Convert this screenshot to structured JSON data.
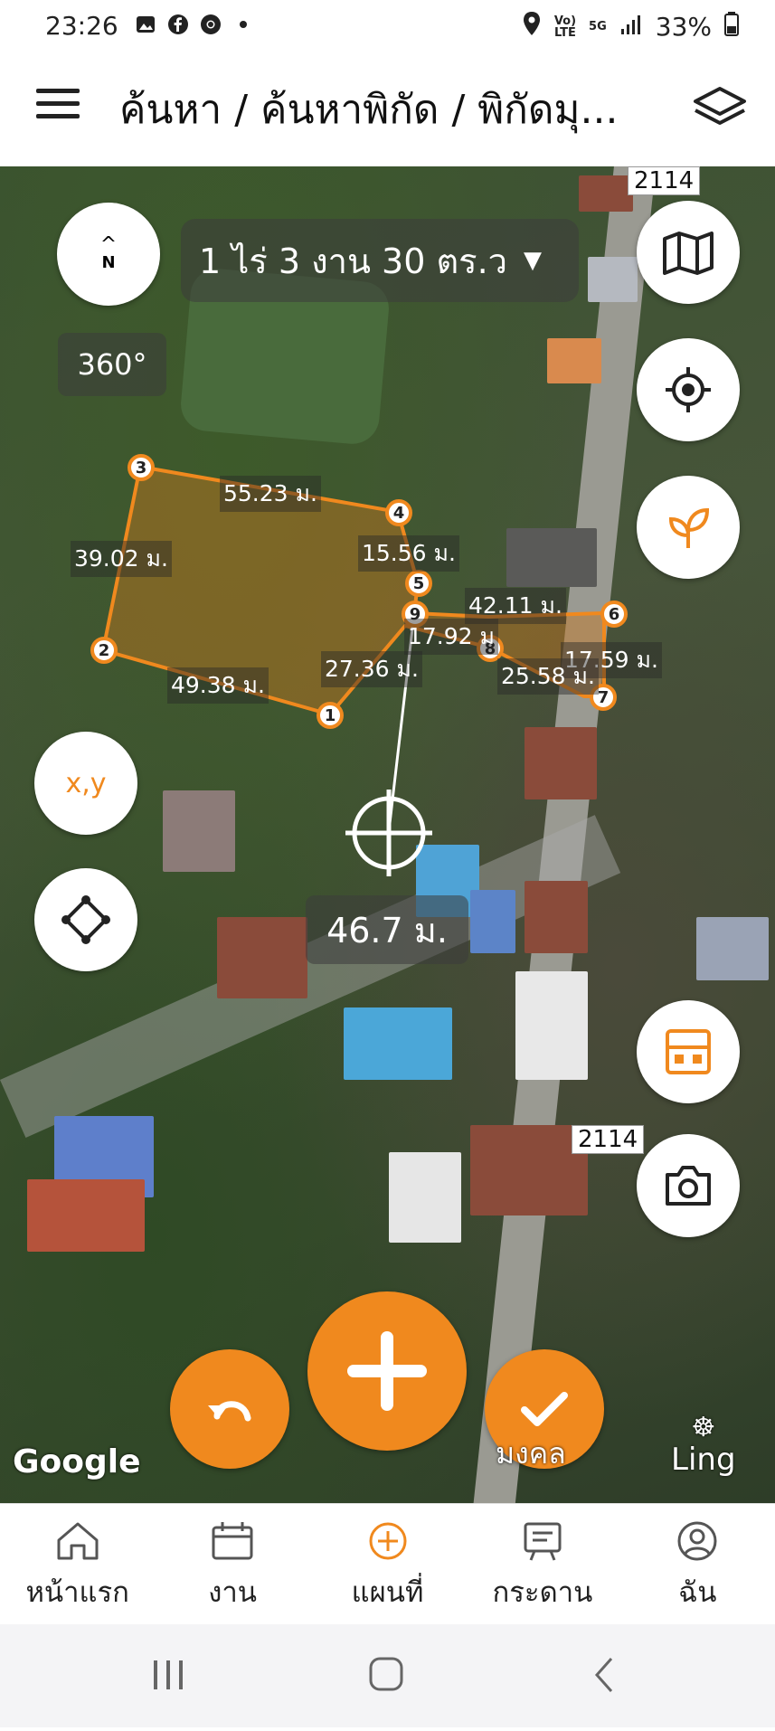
{
  "status": {
    "time": "23:26",
    "battery": "33%",
    "network_top": "Vo)",
    "network_bottom": "LTE",
    "signal_gen": "5G"
  },
  "header": {
    "breadcrumb": "ค้นหา / ค้นหาพิกัด / พิกัดมุ..."
  },
  "map": {
    "area_text": "1 ไร่ 3 งาน 30 ตร.ว",
    "compass_label": "N",
    "rotation_label": "360°",
    "segments": [
      "55.23 ม.",
      "39.02 ม.",
      "15.56 ม.",
      "42.11 ม.",
      "17.92 ม",
      "17.59 ม.",
      "49.38 ม.",
      "27.36 ม.",
      "25.58 ม."
    ],
    "vertices": [
      "1",
      "2",
      "3",
      "4",
      "5",
      "6",
      "7",
      "8",
      "9"
    ],
    "cursor_distance": "46.7 ม.",
    "road_number": "2114",
    "road_number_2": "2114",
    "xy_label": "x,y",
    "attribution": "Google",
    "place_name": "มงคล",
    "ling_label": "Ling"
  },
  "colors": {
    "accent": "#f0891e",
    "parcel_fill": "rgba(200,120,30,0.45)"
  },
  "navbar": {
    "items": [
      "หน้าแรก",
      "งาน",
      "แผนที่",
      "กระดาน",
      "ฉัน"
    ],
    "active": "แผนที่"
  }
}
